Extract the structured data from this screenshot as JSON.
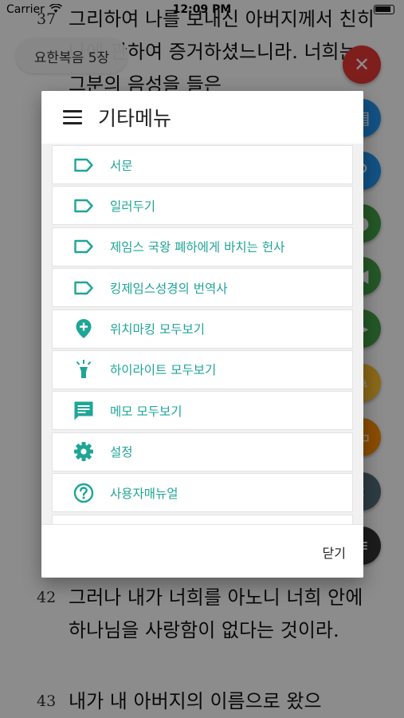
{
  "status_bar": {
    "carrier": "Carrier",
    "time": "12:09 PM"
  },
  "reader": {
    "chapter_chip": "요한복음 5장",
    "verses": [
      {
        "number": "37",
        "text": "그리하여 나를 보내신 아버지께서 친히 나에 관하여 증거하셨느니라. 너희는 그분의 음성을 들은"
      },
      {
        "number": "42",
        "text": "그러나 내가 너희를 아노니 너희 안에 하나님을 사랑함이 없다는 것이라."
      },
      {
        "number": "43",
        "text": "내가 내 아버지의 이름으로 왔으"
      }
    ]
  },
  "modal": {
    "title": "기타메뉴",
    "items": [
      {
        "label": "서문",
        "icon": "label-outline-icon"
      },
      {
        "label": "일러두기",
        "icon": "label-outline-icon"
      },
      {
        "label": "제임스 국왕 폐하에게 바치는 헌사",
        "icon": "label-outline-icon"
      },
      {
        "label": "킹제임스성경의 번역사",
        "icon": "label-outline-icon"
      },
      {
        "label": "위치마킹 모두보기",
        "icon": "location-add-icon"
      },
      {
        "label": "하이라이트 모두보기",
        "icon": "highlight-icon"
      },
      {
        "label": "메모 모두보기",
        "icon": "memo-icon"
      },
      {
        "label": "설정",
        "icon": "gear-icon"
      },
      {
        "label": "사용자매뉴얼",
        "icon": "help-icon"
      }
    ],
    "close_label": "닫기"
  },
  "colors": {
    "accent": "#1ea597",
    "fab_red": "#e53935"
  }
}
